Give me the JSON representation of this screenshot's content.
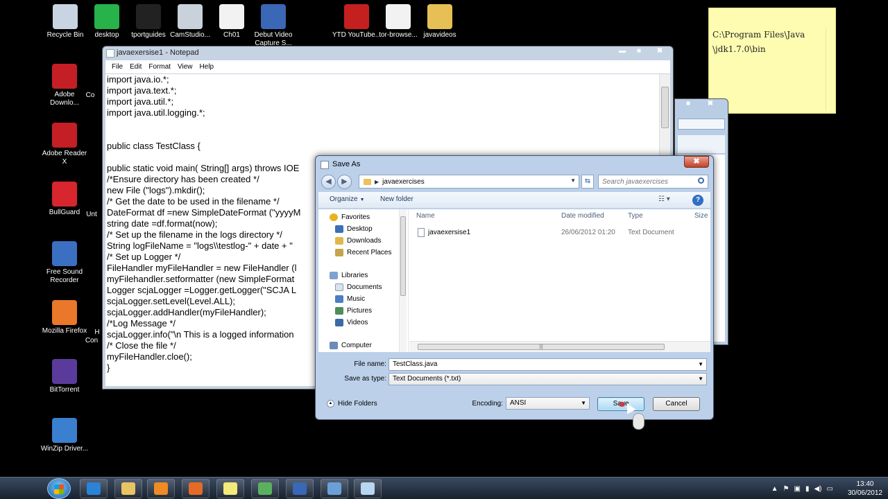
{
  "desktop": {
    "top_icons": [
      {
        "label": "Recycle Bin",
        "color": "#c8d4e2"
      },
      {
        "label": "desktop",
        "color": "#27b24a"
      },
      {
        "label": "tportguides",
        "color": "#222222"
      },
      {
        "label": "CamStudio...",
        "color": "#c9d1da"
      },
      {
        "label": "Ch01",
        "color": "#f2f2f2"
      },
      {
        "label": "Debut Video Capture S...",
        "color": "#3a67b6"
      },
      {
        "label": "YTD YouTube...",
        "color": "#c42020"
      },
      {
        "label": "tor-browse...",
        "color": "#f2f2f2"
      },
      {
        "label": "javavideos",
        "color": "#e6c055"
      }
    ],
    "left_icons": [
      {
        "label": "Adobe Downlo...",
        "color": "#c41f24"
      },
      {
        "label": "Adobe Reader X",
        "color": "#c41f24"
      },
      {
        "label": "BullGuard",
        "color": "#d7262d"
      },
      {
        "label": "Free Sound Recorder",
        "color": "#3b6fc1"
      },
      {
        "label": "Mozilla Firefox",
        "color": "#e9782a"
      },
      {
        "label": "BitTorrent",
        "color": "#5a3b9c"
      },
      {
        "label": "WinZip Driver...",
        "color": "#3a7fd0"
      }
    ],
    "partial_labels": [
      "Co",
      "Unt",
      "H",
      "Con"
    ]
  },
  "sticky_note": {
    "text": "C:\\Program Files\\Java\n\\jdk1.7.0\\bin"
  },
  "notepad": {
    "title": "javaexersise1 - Notepad",
    "menu": [
      "File",
      "Edit",
      "Format",
      "View",
      "Help"
    ],
    "controls": {
      "minimize": "▬",
      "maximize": "■",
      "close": "✖"
    },
    "code": "import java.io.*;\nimport java.text.*;\nimport java.util.*;\nimport java.util.logging.*;\n\n\npublic class TestClass {\n\npublic static void main( String[] args) throws IOE\n/*Ensure directory has been created */\nnew File (\"logs\").mkdir();\n/* Get the date to be used in the filename */\nDateFormat df =new SimpleDateFormat (\"yyyyM\nstring date =df.format(now);\n/* Set up the filename in the logs directory */\nString logFileName = \"logs\\\\testlog-\" + date + \"\n/* Set up Logger */\nFileHandler myFileHandler = new FileHandler (l\nmyFilehandler.setformatter (new SimpleFormat\nLogger scjaLogger =Logger.getLogger(\"SCJA L\nscjaLogger.setLevel(Level.ALL);\nscjaLogger.addHandler(myFileHandler);\n/*Log Message */\nscjaLogger.info(\"\\n This is a logged information\n/* Close the file */\nmyFileHandler.cloe();\n}"
  },
  "save_dialog": {
    "title": "Save As",
    "close": "✖",
    "breadcrumb": "javaexercises",
    "search_placeholder": "Search javaexercises",
    "toolbar": {
      "organize": "Organize",
      "new_folder": "New folder",
      "help": "?"
    },
    "nav": {
      "favorites": "Favorites",
      "desktop": "Desktop",
      "downloads": "Downloads",
      "recent": "Recent Places",
      "libraries": "Libraries",
      "documents": "Documents",
      "music": "Music",
      "pictures": "Pictures",
      "videos": "Videos",
      "computer": "Computer"
    },
    "columns": {
      "name": "Name",
      "date": "Date modified",
      "type": "Type",
      "size": "Size"
    },
    "files": [
      {
        "name": "javaexersise1",
        "date": "26/06/2012 01:20",
        "type": "Text Document"
      }
    ],
    "file_name_label": "File name:",
    "file_name": "TestClass.java",
    "save_as_type_label": "Save as type:",
    "save_as_type": "Text Documents (*.txt)",
    "hide_folders": "Hide Folders",
    "encoding_label": "Encoding:",
    "encoding": "ANSI",
    "save": "Save",
    "cancel": "Cancel"
  },
  "taskbar": {
    "time": "13:40",
    "date": "30/06/2012",
    "buttons": [
      {
        "name": "ie",
        "color": "#2a83d6"
      },
      {
        "name": "explorer",
        "color": "#e9c462"
      },
      {
        "name": "media-player",
        "color": "#f08a24"
      },
      {
        "name": "firefox",
        "color": "#e36b26"
      },
      {
        "name": "sticky-notes",
        "color": "#f2ea7a"
      },
      {
        "name": "network",
        "color": "#5bb05e"
      },
      {
        "name": "debut-video",
        "color": "#3a67b6"
      },
      {
        "name": "remote",
        "color": "#6aa0d8"
      },
      {
        "name": "notepad",
        "color": "#b9d6ef"
      }
    ]
  }
}
